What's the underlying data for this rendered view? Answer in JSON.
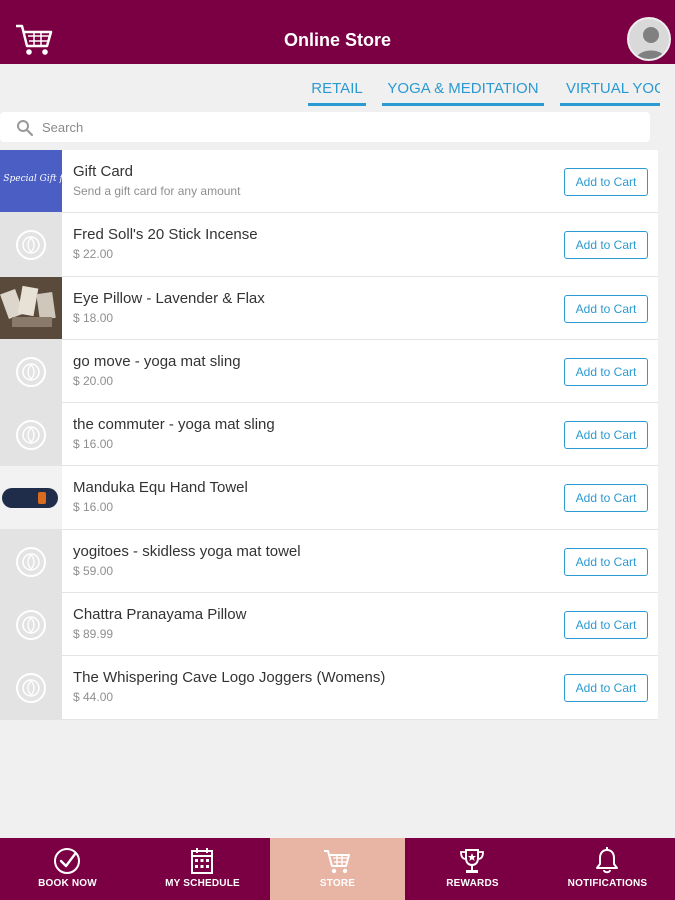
{
  "header": {
    "title": "Online Store",
    "cart_icon": "shopping-cart-icon",
    "avatar_icon": "user-avatar-icon"
  },
  "tabs": [
    {
      "label": "RETAIL"
    },
    {
      "label": "YOGA & MEDITATION"
    },
    {
      "label": "VIRTUAL YOGA"
    }
  ],
  "search": {
    "placeholder": "Search",
    "value": ""
  },
  "products": [
    {
      "name": "Gift Card",
      "subtitle": "Send a gift card for any amount",
      "thumb": "gift-card-image",
      "thumb_text": "A Special Gift for you",
      "button": "Add to Cart"
    },
    {
      "name": "Fred Soll's 20 Stick Incense",
      "subtitle": "$ 22.00",
      "thumb": "placeholder-logo",
      "button": "Add to Cart"
    },
    {
      "name": "Eye Pillow - Lavender & Flax",
      "subtitle": "$ 18.00",
      "thumb": "eye-pillow-photo",
      "button": "Add to Cart"
    },
    {
      "name": "go move - yoga mat sling",
      "subtitle": "$ 20.00",
      "thumb": "placeholder-logo",
      "button": "Add to Cart"
    },
    {
      "name": "the commuter - yoga mat sling",
      "subtitle": "$ 16.00",
      "thumb": "placeholder-logo",
      "button": "Add to Cart"
    },
    {
      "name": "Manduka Equ Hand Towel",
      "subtitle": "$ 16.00",
      "thumb": "towel-photo",
      "button": "Add to Cart"
    },
    {
      "name": "yogitoes - skidless yoga mat towel",
      "subtitle": "$ 59.00",
      "thumb": "placeholder-logo",
      "button": "Add to Cart"
    },
    {
      "name": "Chattra Pranayama Pillow",
      "subtitle": "$ 89.99",
      "thumb": "placeholder-logo",
      "button": "Add to Cart"
    },
    {
      "name": "The Whispering Cave Logo Joggers (Womens)",
      "subtitle": "$ 44.00",
      "thumb": "placeholder-logo",
      "button": "Add to Cart"
    }
  ],
  "nav": [
    {
      "label": "BOOK NOW",
      "icon": "check-circle-icon",
      "active": false
    },
    {
      "label": "MY SCHEDULE",
      "icon": "calendar-icon",
      "active": false
    },
    {
      "label": "STORE",
      "icon": "shopping-cart-icon",
      "active": true
    },
    {
      "label": "REWARDS",
      "icon": "trophy-icon",
      "active": false
    },
    {
      "label": "NOTIFICATIONS",
      "icon": "bell-icon",
      "active": false
    }
  ],
  "colors": {
    "brand": "#7a0043",
    "accent": "#2b9ad1",
    "active_tab_bg": "#e8b5a4"
  }
}
